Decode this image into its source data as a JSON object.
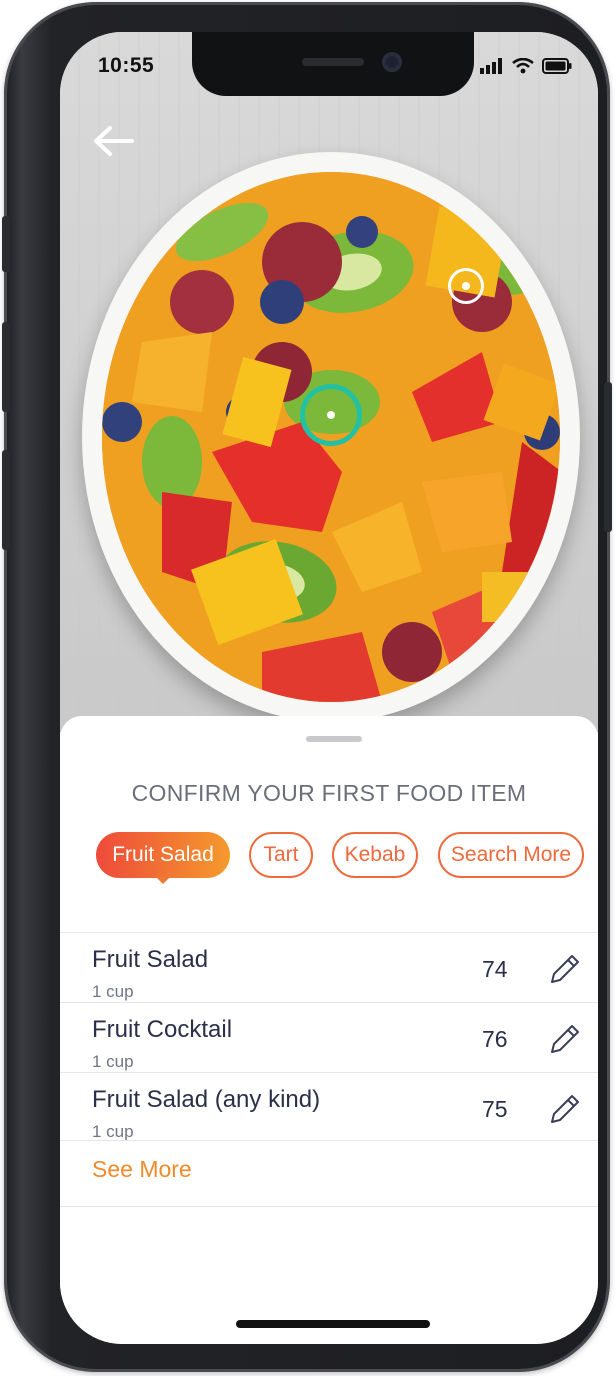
{
  "status_bar": {
    "time": "10:55"
  },
  "navigation": {
    "back_icon": "arrow-left-icon"
  },
  "sheet": {
    "title": "CONFIRM YOUR FIRST FOOD ITEM",
    "chips": [
      {
        "label": "Fruit Salad",
        "selected": true
      },
      {
        "label": "Tart",
        "selected": false
      },
      {
        "label": "Kebab",
        "selected": false
      },
      {
        "label": "Search More",
        "selected": false
      }
    ],
    "items": [
      {
        "name": "Fruit Salad",
        "serving": "1 cup",
        "calories": "74"
      },
      {
        "name": "Fruit Cocktail",
        "serving": "1 cup",
        "calories": "76"
      },
      {
        "name": "Fruit Salad (any kind)",
        "serving": "1 cup",
        "calories": "75"
      }
    ],
    "see_more": "See More"
  },
  "colors": {
    "accent_orange": "#ee6a3c",
    "marker_teal": "#22c1a4",
    "text_dark": "#2a2f4a"
  }
}
